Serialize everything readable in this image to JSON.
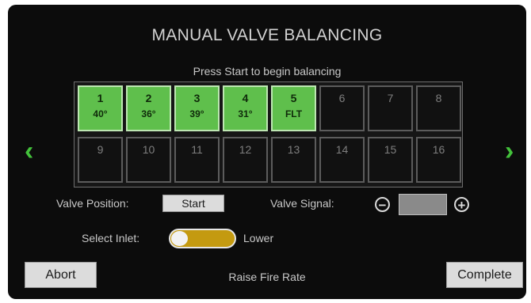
{
  "title": "MANUAL VALVE BALANCING",
  "subtitle": "Press Start to begin balancing",
  "valves_row1": [
    {
      "num": "1",
      "value": "40°",
      "active": true
    },
    {
      "num": "2",
      "value": "36°",
      "active": true
    },
    {
      "num": "3",
      "value": "39°",
      "active": true
    },
    {
      "num": "4",
      "value": "31°",
      "active": true
    },
    {
      "num": "5",
      "value": "FLT",
      "active": true
    },
    {
      "num": "6",
      "value": "",
      "active": false
    },
    {
      "num": "7",
      "value": "",
      "active": false
    },
    {
      "num": "8",
      "value": "",
      "active": false
    }
  ],
  "valves_row2": [
    {
      "num": "9",
      "value": "",
      "active": false
    },
    {
      "num": "10",
      "value": "",
      "active": false
    },
    {
      "num": "11",
      "value": "",
      "active": false
    },
    {
      "num": "12",
      "value": "",
      "active": false
    },
    {
      "num": "13",
      "value": "",
      "active": false
    },
    {
      "num": "14",
      "value": "",
      "active": false
    },
    {
      "num": "15",
      "value": "",
      "active": false
    },
    {
      "num": "16",
      "value": "",
      "active": false
    }
  ],
  "nav": {
    "prev_glyph": "‹",
    "next_glyph": "›"
  },
  "valve_position": {
    "label": "Valve Position:",
    "button": "Start"
  },
  "valve_signal": {
    "label": "Valve Signal:",
    "minus": "−",
    "plus": "+",
    "value": ""
  },
  "inlet": {
    "label": "Select Inlet:",
    "selected": "Lower"
  },
  "footer": {
    "abort": "Abort",
    "status": "Raise Fire Rate",
    "complete": "Complete"
  },
  "colors": {
    "active_cell": "#5fbf4c",
    "accent_arrow": "#43c23b",
    "toggle": "#c49a10"
  }
}
